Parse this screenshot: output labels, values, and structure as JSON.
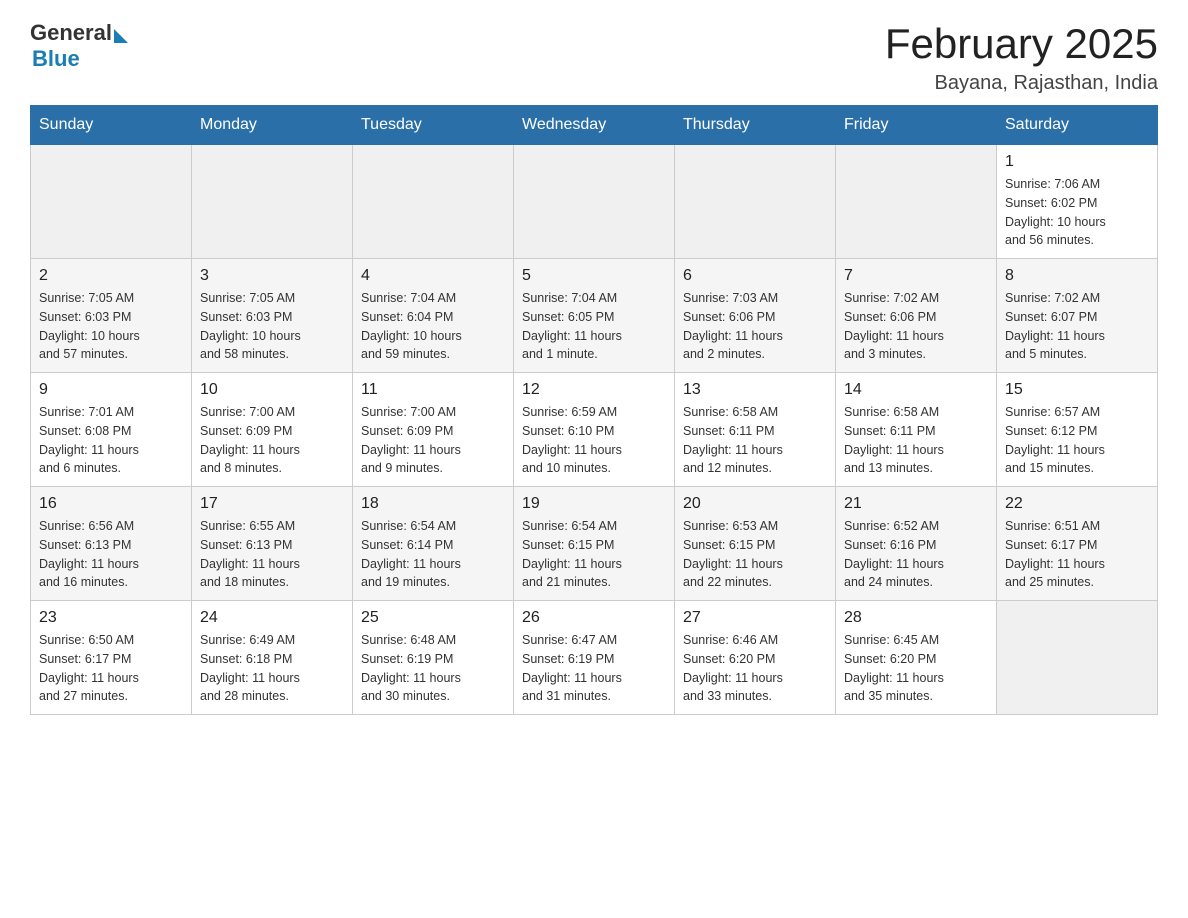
{
  "logo": {
    "general": "General",
    "blue": "Blue"
  },
  "title": "February 2025",
  "location": "Bayana, Rajasthan, India",
  "weekdays": [
    "Sunday",
    "Monday",
    "Tuesday",
    "Wednesday",
    "Thursday",
    "Friday",
    "Saturday"
  ],
  "weeks": [
    [
      {
        "day": "",
        "info": ""
      },
      {
        "day": "",
        "info": ""
      },
      {
        "day": "",
        "info": ""
      },
      {
        "day": "",
        "info": ""
      },
      {
        "day": "",
        "info": ""
      },
      {
        "day": "",
        "info": ""
      },
      {
        "day": "1",
        "info": "Sunrise: 7:06 AM\nSunset: 6:02 PM\nDaylight: 10 hours\nand 56 minutes."
      }
    ],
    [
      {
        "day": "2",
        "info": "Sunrise: 7:05 AM\nSunset: 6:03 PM\nDaylight: 10 hours\nand 57 minutes."
      },
      {
        "day": "3",
        "info": "Sunrise: 7:05 AM\nSunset: 6:03 PM\nDaylight: 10 hours\nand 58 minutes."
      },
      {
        "day": "4",
        "info": "Sunrise: 7:04 AM\nSunset: 6:04 PM\nDaylight: 10 hours\nand 59 minutes."
      },
      {
        "day": "5",
        "info": "Sunrise: 7:04 AM\nSunset: 6:05 PM\nDaylight: 11 hours\nand 1 minute."
      },
      {
        "day": "6",
        "info": "Sunrise: 7:03 AM\nSunset: 6:06 PM\nDaylight: 11 hours\nand 2 minutes."
      },
      {
        "day": "7",
        "info": "Sunrise: 7:02 AM\nSunset: 6:06 PM\nDaylight: 11 hours\nand 3 minutes."
      },
      {
        "day": "8",
        "info": "Sunrise: 7:02 AM\nSunset: 6:07 PM\nDaylight: 11 hours\nand 5 minutes."
      }
    ],
    [
      {
        "day": "9",
        "info": "Sunrise: 7:01 AM\nSunset: 6:08 PM\nDaylight: 11 hours\nand 6 minutes."
      },
      {
        "day": "10",
        "info": "Sunrise: 7:00 AM\nSunset: 6:09 PM\nDaylight: 11 hours\nand 8 minutes."
      },
      {
        "day": "11",
        "info": "Sunrise: 7:00 AM\nSunset: 6:09 PM\nDaylight: 11 hours\nand 9 minutes."
      },
      {
        "day": "12",
        "info": "Sunrise: 6:59 AM\nSunset: 6:10 PM\nDaylight: 11 hours\nand 10 minutes."
      },
      {
        "day": "13",
        "info": "Sunrise: 6:58 AM\nSunset: 6:11 PM\nDaylight: 11 hours\nand 12 minutes."
      },
      {
        "day": "14",
        "info": "Sunrise: 6:58 AM\nSunset: 6:11 PM\nDaylight: 11 hours\nand 13 minutes."
      },
      {
        "day": "15",
        "info": "Sunrise: 6:57 AM\nSunset: 6:12 PM\nDaylight: 11 hours\nand 15 minutes."
      }
    ],
    [
      {
        "day": "16",
        "info": "Sunrise: 6:56 AM\nSunset: 6:13 PM\nDaylight: 11 hours\nand 16 minutes."
      },
      {
        "day": "17",
        "info": "Sunrise: 6:55 AM\nSunset: 6:13 PM\nDaylight: 11 hours\nand 18 minutes."
      },
      {
        "day": "18",
        "info": "Sunrise: 6:54 AM\nSunset: 6:14 PM\nDaylight: 11 hours\nand 19 minutes."
      },
      {
        "day": "19",
        "info": "Sunrise: 6:54 AM\nSunset: 6:15 PM\nDaylight: 11 hours\nand 21 minutes."
      },
      {
        "day": "20",
        "info": "Sunrise: 6:53 AM\nSunset: 6:15 PM\nDaylight: 11 hours\nand 22 minutes."
      },
      {
        "day": "21",
        "info": "Sunrise: 6:52 AM\nSunset: 6:16 PM\nDaylight: 11 hours\nand 24 minutes."
      },
      {
        "day": "22",
        "info": "Sunrise: 6:51 AM\nSunset: 6:17 PM\nDaylight: 11 hours\nand 25 minutes."
      }
    ],
    [
      {
        "day": "23",
        "info": "Sunrise: 6:50 AM\nSunset: 6:17 PM\nDaylight: 11 hours\nand 27 minutes."
      },
      {
        "day": "24",
        "info": "Sunrise: 6:49 AM\nSunset: 6:18 PM\nDaylight: 11 hours\nand 28 minutes."
      },
      {
        "day": "25",
        "info": "Sunrise: 6:48 AM\nSunset: 6:19 PM\nDaylight: 11 hours\nand 30 minutes."
      },
      {
        "day": "26",
        "info": "Sunrise: 6:47 AM\nSunset: 6:19 PM\nDaylight: 11 hours\nand 31 minutes."
      },
      {
        "day": "27",
        "info": "Sunrise: 6:46 AM\nSunset: 6:20 PM\nDaylight: 11 hours\nand 33 minutes."
      },
      {
        "day": "28",
        "info": "Sunrise: 6:45 AM\nSunset: 6:20 PM\nDaylight: 11 hours\nand 35 minutes."
      },
      {
        "day": "",
        "info": ""
      }
    ]
  ]
}
